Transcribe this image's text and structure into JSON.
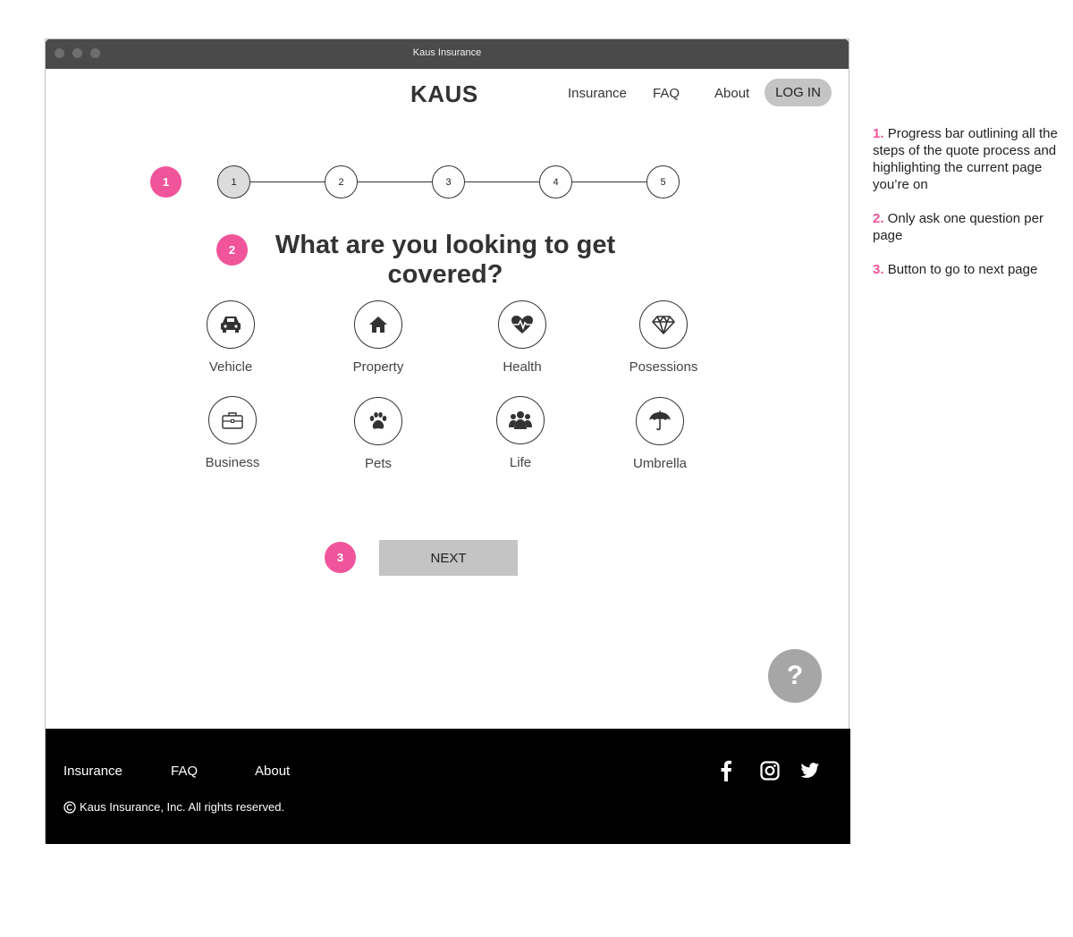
{
  "window": {
    "title": "Kaus Insurance"
  },
  "header": {
    "logo": "KAUS",
    "nav": [
      "Insurance",
      "FAQ",
      "About"
    ],
    "login_label": "LOG IN"
  },
  "annotation_markers": [
    "1",
    "2",
    "3"
  ],
  "progress": {
    "steps": [
      "1",
      "2",
      "3",
      "4",
      "5"
    ],
    "current_step": 1
  },
  "question": "What are you looking to get covered?",
  "options": [
    {
      "label": "Vehicle",
      "icon": "car-icon"
    },
    {
      "label": "Property",
      "icon": "house-icon"
    },
    {
      "label": "Health",
      "icon": "heartbeat-icon"
    },
    {
      "label": "Posessions",
      "icon": "diamond-icon"
    },
    {
      "label": "Business",
      "icon": "briefcase-icon"
    },
    {
      "label": "Pets",
      "icon": "paw-icon"
    },
    {
      "label": "Life",
      "icon": "family-icon"
    },
    {
      "label": "Umbrella",
      "icon": "umbrella-icon"
    }
  ],
  "next_label": "NEXT",
  "help_label": "?",
  "footer": {
    "links": [
      "Insurance",
      "FAQ",
      "About"
    ],
    "copyright": "Kaus Insurance, Inc. All rights reserved.",
    "social": [
      "facebook-icon",
      "instagram-icon",
      "twitter-icon"
    ]
  },
  "notes": [
    {
      "num": "1.",
      "text": "Progress bar outlining all the steps of the quote process and highlighting the current page you’re on"
    },
    {
      "num": "2.",
      "text": " Only ask one question per page"
    },
    {
      "num": "3.",
      "text": "Button to go to next page"
    }
  ],
  "colors": {
    "accent": "#f0549a",
    "button": "#c4c4c4",
    "footer": "#000000",
    "titlebar": "#4a4a4a"
  }
}
